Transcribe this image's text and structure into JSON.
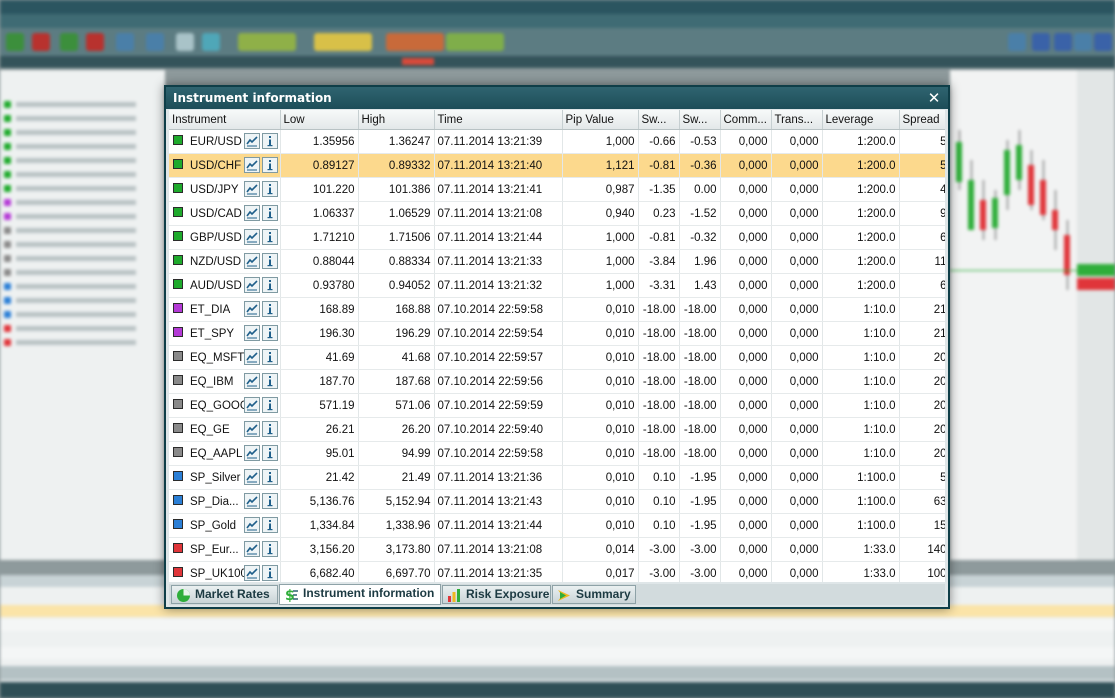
{
  "dialog": {
    "title": "Instrument information",
    "close_glyph": "✕"
  },
  "grid": {
    "columns": [
      "Instrument",
      "Low",
      "High",
      "Time",
      "Pip Value",
      "Sw...",
      "Sw...",
      "Comm...",
      "Trans...",
      "Leverage",
      "Spread"
    ],
    "selected_index": 1,
    "rows": [
      {
        "instrument": "EUR/USD",
        "color": "#1faa2c",
        "low": "1.35956",
        "high": "1.36247",
        "time": "07.11.2014 13:21:39",
        "pip": "1,000",
        "swap_long": "-0.66",
        "swap_short": "-0.53",
        "comm": "0,000",
        "trans": "0,000",
        "leverage": "1:200.0",
        "spread": "5"
      },
      {
        "instrument": "USD/CHF",
        "color": "#1faa2c",
        "low": "0.89127",
        "high": "0.89332",
        "time": "07.11.2014 13:21:40",
        "pip": "1,121",
        "swap_long": "-0.81",
        "swap_short": "-0.36",
        "comm": "0,000",
        "trans": "0,000",
        "leverage": "1:200.0",
        "spread": "5"
      },
      {
        "instrument": "USD/JPY",
        "color": "#1faa2c",
        "low": "101.220",
        "high": "101.386",
        "time": "07.11.2014 13:21:41",
        "pip": "0,987",
        "swap_long": "-1.35",
        "swap_short": "0.00",
        "comm": "0,000",
        "trans": "0,000",
        "leverage": "1:200.0",
        "spread": "4"
      },
      {
        "instrument": "USD/CAD",
        "color": "#1faa2c",
        "low": "1.06337",
        "high": "1.06529",
        "time": "07.11.2014 13:21:08",
        "pip": "0,940",
        "swap_long": "0.23",
        "swap_short": "-1.52",
        "comm": "0,000",
        "trans": "0,000",
        "leverage": "1:200.0",
        "spread": "9"
      },
      {
        "instrument": "GBP/USD",
        "color": "#1faa2c",
        "low": "1.71210",
        "high": "1.71506",
        "time": "07.11.2014 13:21:44",
        "pip": "1,000",
        "swap_long": "-0.81",
        "swap_short": "-0.32",
        "comm": "0,000",
        "trans": "0,000",
        "leverage": "1:200.0",
        "spread": "6"
      },
      {
        "instrument": "NZD/USD",
        "color": "#1faa2c",
        "low": "0.88044",
        "high": "0.88334",
        "time": "07.11.2014 13:21:33",
        "pip": "1,000",
        "swap_long": "-3.84",
        "swap_short": "1.96",
        "comm": "0,000",
        "trans": "0,000",
        "leverage": "1:200.0",
        "spread": "11"
      },
      {
        "instrument": "AUD/USD",
        "color": "#1faa2c",
        "low": "0.93780",
        "high": "0.94052",
        "time": "07.11.2014 13:21:32",
        "pip": "1,000",
        "swap_long": "-3.31",
        "swap_short": "1.43",
        "comm": "0,000",
        "trans": "0,000",
        "leverage": "1:200.0",
        "spread": "6"
      },
      {
        "instrument": "ET_DIA",
        "color": "#b43ad6",
        "low": "168.89",
        "high": "168.88",
        "time": "07.10.2014 22:59:58",
        "pip": "0,010",
        "swap_long": "-18.00",
        "swap_short": "-18.00",
        "comm": "0,000",
        "trans": "0,000",
        "leverage": "1:10.0",
        "spread": "21"
      },
      {
        "instrument": "ET_SPY",
        "color": "#b43ad6",
        "low": "196.30",
        "high": "196.29",
        "time": "07.10.2014 22:59:54",
        "pip": "0,010",
        "swap_long": "-18.00",
        "swap_short": "-18.00",
        "comm": "0,000",
        "trans": "0,000",
        "leverage": "1:10.0",
        "spread": "21"
      },
      {
        "instrument": "EQ_MSFT",
        "color": "#8a8a8a",
        "low": "41.69",
        "high": "41.68",
        "time": "07.10.2014 22:59:57",
        "pip": "0,010",
        "swap_long": "-18.00",
        "swap_short": "-18.00",
        "comm": "0,000",
        "trans": "0,000",
        "leverage": "1:10.0",
        "spread": "20"
      },
      {
        "instrument": "EQ_IBM",
        "color": "#8a8a8a",
        "low": "187.70",
        "high": "187.68",
        "time": "07.10.2014 22:59:56",
        "pip": "0,010",
        "swap_long": "-18.00",
        "swap_short": "-18.00",
        "comm": "0,000",
        "trans": "0,000",
        "leverage": "1:10.0",
        "spread": "20"
      },
      {
        "instrument": "EQ_GOOG",
        "color": "#8a8a8a",
        "low": "571.19",
        "high": "571.06",
        "time": "07.10.2014 22:59:59",
        "pip": "0,010",
        "swap_long": "-18.00",
        "swap_short": "-18.00",
        "comm": "0,000",
        "trans": "0,000",
        "leverage": "1:10.0",
        "spread": "20"
      },
      {
        "instrument": "EQ_GE",
        "color": "#8a8a8a",
        "low": "26.21",
        "high": "26.20",
        "time": "07.10.2014 22:59:40",
        "pip": "0,010",
        "swap_long": "-18.00",
        "swap_short": "-18.00",
        "comm": "0,000",
        "trans": "0,000",
        "leverage": "1:10.0",
        "spread": "20"
      },
      {
        "instrument": "EQ_AAPL",
        "color": "#8a8a8a",
        "low": "95.01",
        "high": "94.99",
        "time": "07.10.2014 22:59:58",
        "pip": "0,010",
        "swap_long": "-18.00",
        "swap_short": "-18.00",
        "comm": "0,000",
        "trans": "0,000",
        "leverage": "1:10.0",
        "spread": "20"
      },
      {
        "instrument": "SP_Silver",
        "color": "#2b7fd6",
        "low": "21.42",
        "high": "21.49",
        "time": "07.11.2014 13:21:36",
        "pip": "0,010",
        "swap_long": "0.10",
        "swap_short": "-1.95",
        "comm": "0,000",
        "trans": "0,000",
        "leverage": "1:100.0",
        "spread": "5"
      },
      {
        "instrument": "SP_Dia...",
        "color": "#2b7fd6",
        "low": "5,136.76",
        "high": "5,152.94",
        "time": "07.11.2014 13:21:43",
        "pip": "0,010",
        "swap_long": "0.10",
        "swap_short": "-1.95",
        "comm": "0,000",
        "trans": "0,000",
        "leverage": "1:100.0",
        "spread": "63"
      },
      {
        "instrument": "SP_Gold",
        "color": "#2b7fd6",
        "low": "1,334.84",
        "high": "1,338.96",
        "time": "07.11.2014 13:21:44",
        "pip": "0,010",
        "swap_long": "0.10",
        "swap_short": "-1.95",
        "comm": "0,000",
        "trans": "0,000",
        "leverage": "1:100.0",
        "spread": "15"
      },
      {
        "instrument": "SP_Eur...",
        "color": "#e0353a",
        "low": "3,156.20",
        "high": "3,173.80",
        "time": "07.11.2014 13:21:08",
        "pip": "0,014",
        "swap_long": "-3.00",
        "swap_short": "-3.00",
        "comm": "0,000",
        "trans": "0,000",
        "leverage": "1:33.0",
        "spread": "140"
      },
      {
        "instrument": "SP_UK100",
        "color": "#e0353a",
        "low": "6,682.40",
        "high": "6,697.70",
        "time": "07.11.2014 13:21:35",
        "pip": "0,017",
        "swap_long": "-3.00",
        "swap_short": "-3.00",
        "comm": "0,000",
        "trans": "0,000",
        "leverage": "1:33.0",
        "spread": "100"
      }
    ],
    "row_icons": [
      "chart-icon",
      "info-icon"
    ]
  },
  "tabs": [
    {
      "label": "Market Rates",
      "icon": "pie-chart-icon",
      "active": false
    },
    {
      "label": "Instrument information",
      "icon": "dollar-icon",
      "active": true
    },
    {
      "label": "Risk Exposure",
      "icon": "bar-chart-icon",
      "active": false
    },
    {
      "label": "Summary",
      "icon": "summary-arrow-icon",
      "active": false
    }
  ],
  "colors": {
    "accent_title": "#1d4d58",
    "selected_row": "#fcd98d",
    "forex": "#1faa2c",
    "etf": "#b43ad6",
    "equity": "#8a8a8a",
    "commodity": "#2b7fd6",
    "index": "#e0353a"
  }
}
